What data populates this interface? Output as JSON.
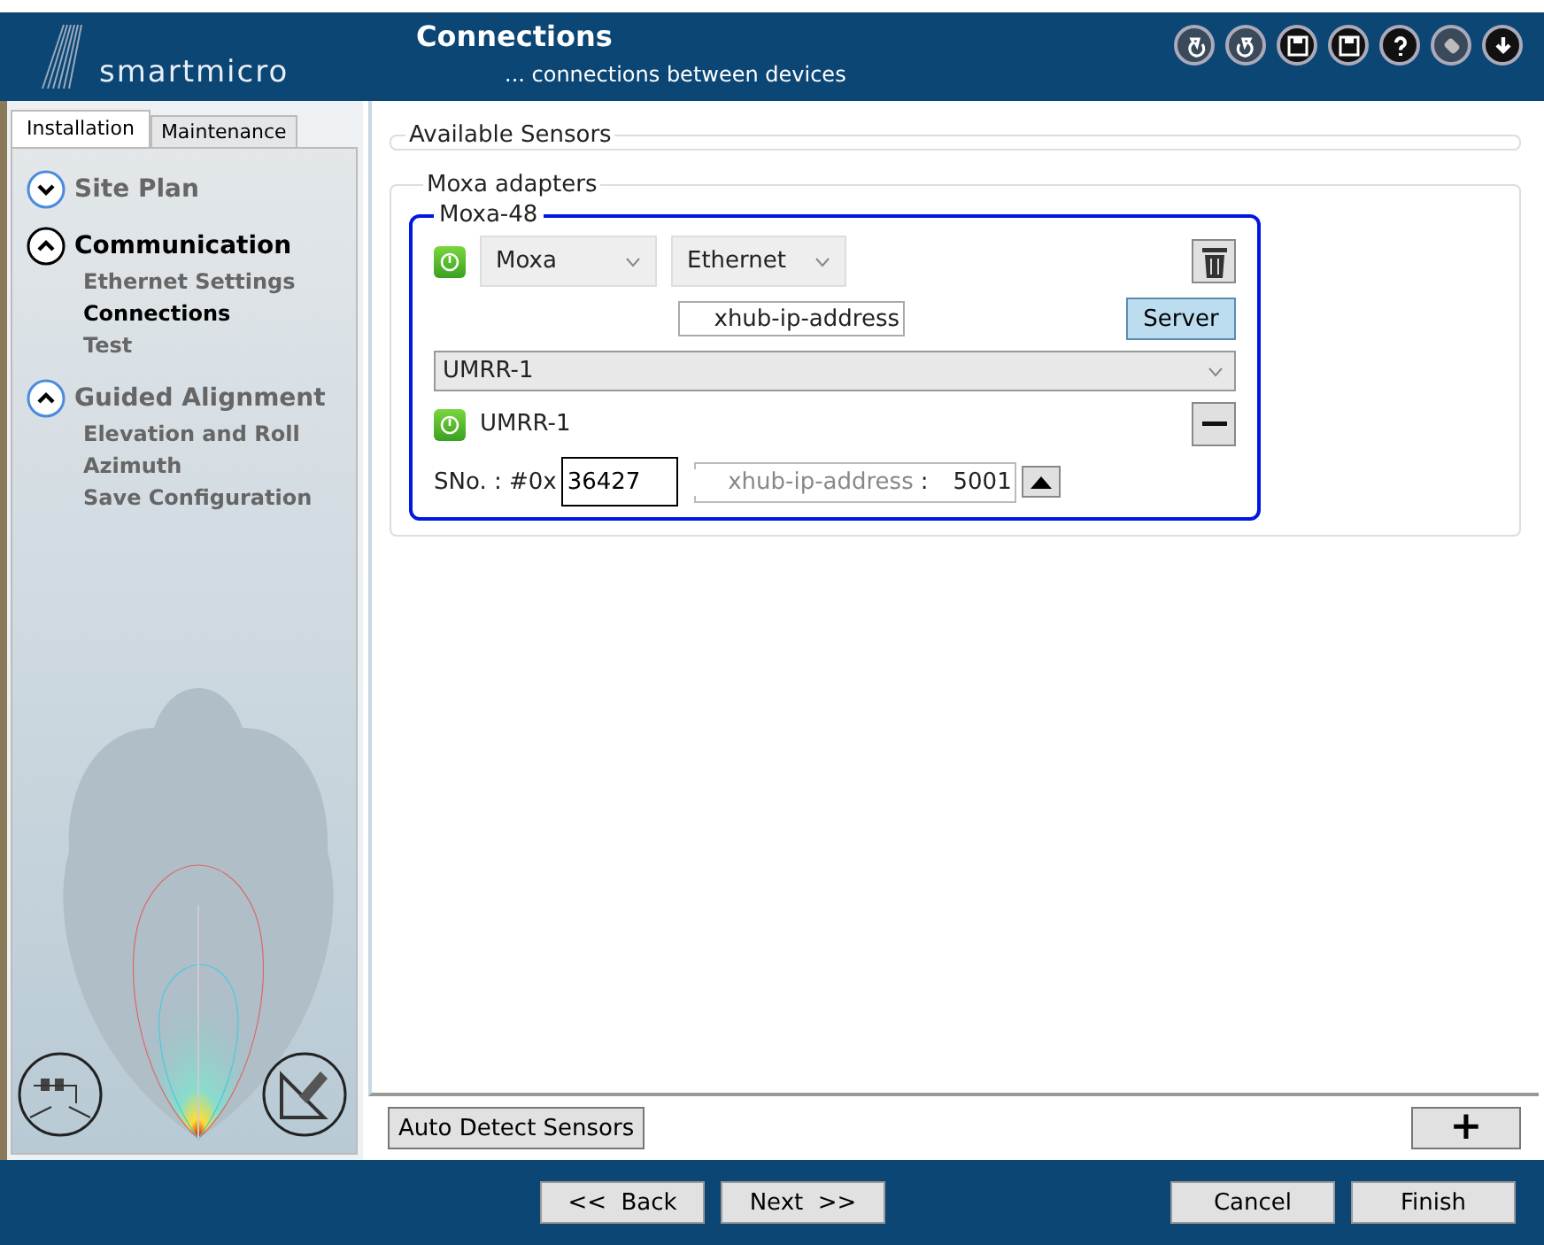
{
  "header": {
    "brand": "smartmicro",
    "title": "Connections",
    "subtitle": "... connections between devices"
  },
  "sidebar": {
    "tabs": [
      {
        "label": "Installation",
        "selected": true
      },
      {
        "label": "Maintenance",
        "selected": false
      }
    ],
    "sections": [
      {
        "title": "Site Plan",
        "expanded": false,
        "current": false
      },
      {
        "title": "Communication",
        "expanded": true,
        "current": true,
        "children": [
          {
            "label": "Ethernet Settings",
            "current": false
          },
          {
            "label": "Connections",
            "current": true
          },
          {
            "label": "Test",
            "current": false
          }
        ]
      },
      {
        "title": "Guided Alignment",
        "expanded": true,
        "current": false,
        "children": [
          {
            "label": "Elevation and Roll",
            "current": false
          },
          {
            "label": "Azimuth",
            "current": false
          },
          {
            "label": "Save Configuration",
            "current": false
          }
        ]
      }
    ]
  },
  "available_sensors": {
    "title": "Available Sensors"
  },
  "adapters": {
    "title": "Moxa adapters",
    "items": [
      {
        "title": "Moxa-48",
        "on": true,
        "type": "Moxa",
        "connection": "Ethernet",
        "ip": "xhub-ip-address",
        "mode_button": "Server",
        "sensor_select": "UMRR-1",
        "sensor": {
          "name": "UMRR-1",
          "on": true,
          "sno_label": "SNo. : #0x",
          "sno": "36427",
          "ip_placeholder": "xhub-ip-address",
          "separator": ":",
          "port": "5001"
        }
      }
    ]
  },
  "actions": {
    "auto_detect": "Auto Detect Sensors",
    "add": "+"
  },
  "footer": {
    "back": "<<  Back",
    "next": "Next  >>",
    "cancel": "Cancel",
    "finish": "Finish"
  }
}
